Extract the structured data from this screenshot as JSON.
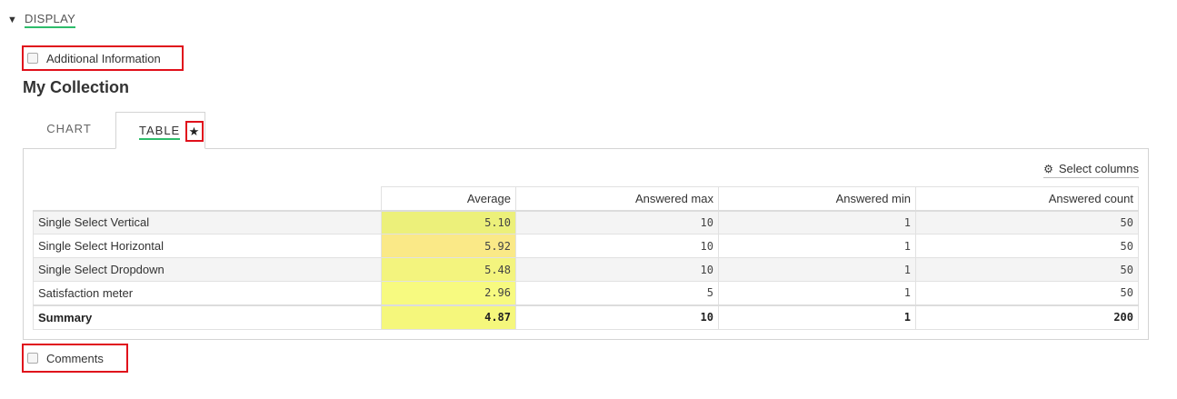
{
  "section": {
    "label": "DISPLAY",
    "caret": "▼"
  },
  "additional_info": {
    "label": "Additional Information"
  },
  "collection": {
    "title": "My Collection"
  },
  "tabs": [
    {
      "label": "CHART"
    },
    {
      "label": "TABLE",
      "icon": "star-icon"
    }
  ],
  "toolbar": {
    "select_columns_label": "Select columns",
    "icon": "gear-icon"
  },
  "table": {
    "headers": [
      "",
      "Average",
      "Answered max",
      "Answered min",
      "Answered count"
    ],
    "rows": [
      {
        "label": "Single Select Vertical",
        "average": "5.10",
        "max": "10",
        "min": "1",
        "count": "50",
        "heat_color": "#ecf07a"
      },
      {
        "label": "Single Select Horizontal",
        "average": "5.92",
        "max": "10",
        "min": "1",
        "count": "50",
        "heat_color": "#fae987"
      },
      {
        "label": "Single Select Dropdown",
        "average": "5.48",
        "max": "10",
        "min": "1",
        "count": "50",
        "heat_color": "#f3f47e"
      },
      {
        "label": "Satisfaction meter",
        "average": "2.96",
        "max": "5",
        "min": "1",
        "count": "50",
        "heat_color": "#f7fa80"
      }
    ],
    "summary": {
      "label": "Summary",
      "average": "4.87",
      "max": "10",
      "min": "1",
      "count": "200",
      "heat_color": "#f5f77c"
    }
  },
  "comments": {
    "label": "Comments"
  },
  "colors": {
    "accent_underline": "#2ebd6b",
    "highlight_border": "#e0101b"
  }
}
